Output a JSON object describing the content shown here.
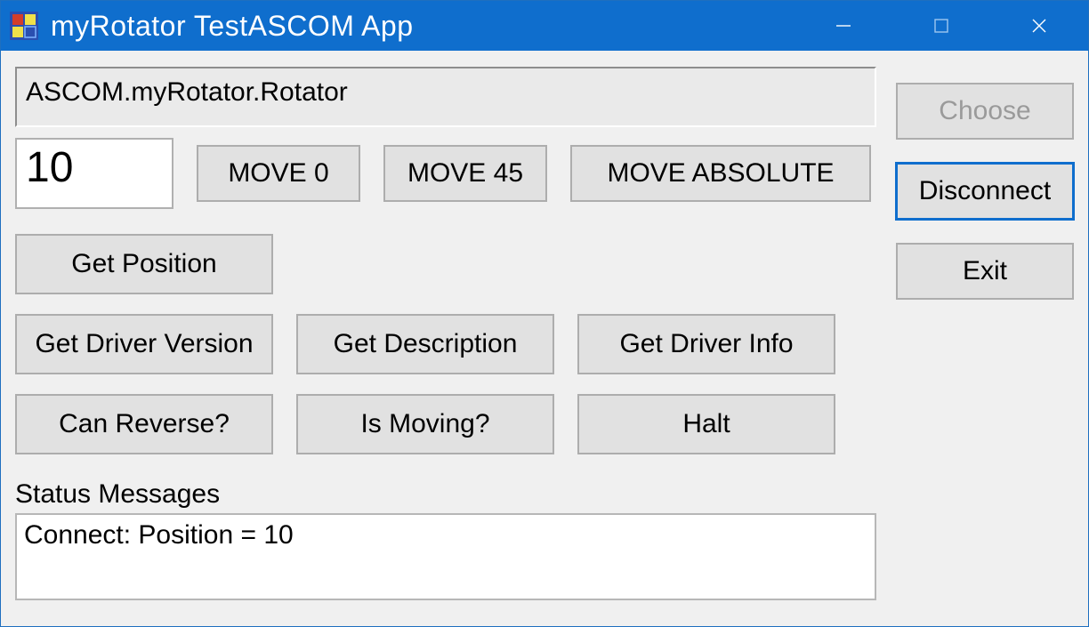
{
  "window": {
    "title": "myRotator TestASCOM App"
  },
  "driver_id": "ASCOM.myRotator.Rotator",
  "position_input": "10",
  "buttons": {
    "move_0": "MOVE 0",
    "move_45": "MOVE 45",
    "move_absolute": "MOVE ABSOLUTE",
    "get_position": "Get Position",
    "get_driver_version": "Get Driver Version",
    "get_description": "Get Description",
    "get_driver_info": "Get Driver Info",
    "can_reverse": "Can Reverse?",
    "is_moving": "Is Moving?",
    "halt": "Halt",
    "choose": "Choose",
    "disconnect": "Disconnect",
    "exit": "Exit"
  },
  "status": {
    "label": "Status Messages",
    "text": "Connect: Position = 10"
  }
}
